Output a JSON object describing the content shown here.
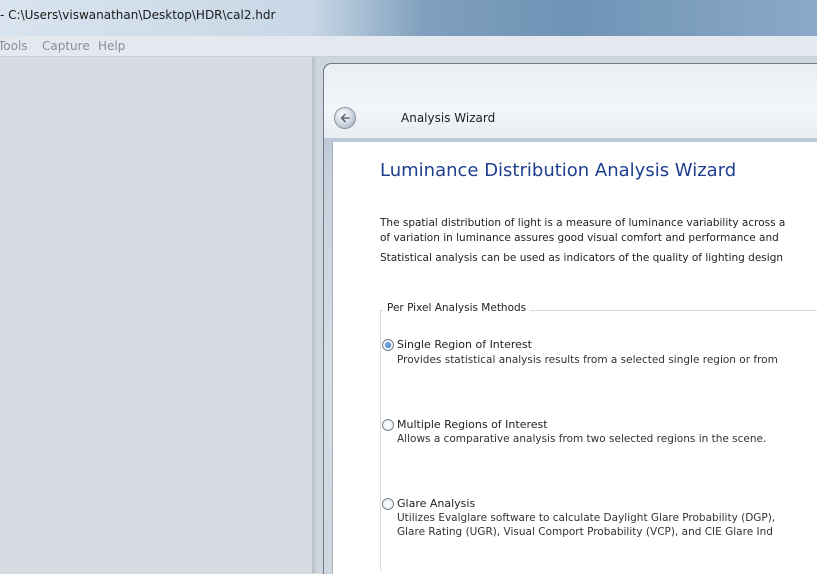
{
  "window": {
    "title": "- C:\\Users\\viswanathan\\Desktop\\HDR\\cal2.hdr"
  },
  "menu": [
    "Tools",
    "Capture",
    "Help"
  ],
  "wizard": {
    "window_title": "Analysis Wizard",
    "back_icon": "back-arrow-icon",
    "heading": "Luminance Distribution Analysis Wizard",
    "intro_lines": [
      "The spatial distribution of light is a measure of luminance variability across a",
      "of variation in luminance assures good visual comfort and performance and",
      "Statistical analysis can be used as indicators of the quality of lighting design"
    ],
    "group_label": "Per Pixel Analysis Methods",
    "options": [
      {
        "label": "Single Region of Interest",
        "desc": [
          "Provides statistical analysis results from a selected single region or from"
        ],
        "checked": true
      },
      {
        "label": "Multiple Regions of Interest",
        "desc": [
          "Allows a comparative analysis from two selected regions in the scene."
        ],
        "checked": false
      },
      {
        "label": "Glare Analysis",
        "desc": [
          "Utilizes Evalglare software to calculate Daylight Glare Probability (DGP),",
          "Glare Rating (UGR), Visual Comport Probability (VCP), and CIE Glare Ind"
        ],
        "checked": false
      }
    ]
  },
  "colors": {
    "heading": "#1f3f8f",
    "radio_selected": "#2a6fc4"
  }
}
